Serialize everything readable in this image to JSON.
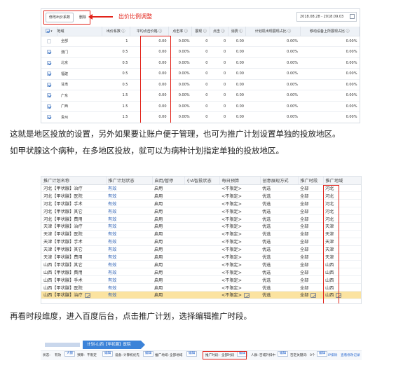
{
  "shot1": {
    "adjust_button": "修改出价系数",
    "delete_button": "删除",
    "annotation": "出价比例调整",
    "date_range": "2018.08.28 - 2018.09.03",
    "headers": [
      "地域",
      "出价系数 ⓘ",
      "平均点击价格 ⓘ",
      "点击率 ⓘ",
      "展现 ⓘ",
      "点击 ⓘ",
      "消费 ⓘ",
      "计划机出现展现占比 ⓘ",
      "移动设备上所展现占比 ⓘ"
    ],
    "rows": [
      {
        "checked": false,
        "region": "全部",
        "ratio": "1",
        "avg": "0.00",
        "ctr": "0.00%",
        "imp": "0",
        "clk": "0",
        "cost": "0.00",
        "share1": "0.00%",
        "share2": "0.00%"
      },
      {
        "checked": true,
        "region": "澳门",
        "ratio": "0.5",
        "avg": "0.00",
        "ctr": "0.00%",
        "imp": "0",
        "clk": "0",
        "cost": "0.00",
        "share1": "0.00%",
        "share2": "0.00%"
      },
      {
        "checked": true,
        "region": "北京",
        "ratio": "0.5",
        "avg": "0.00",
        "ctr": "0.00%",
        "imp": "0",
        "clk": "0",
        "cost": "0.00",
        "share1": "0.00%",
        "share2": "0.00%"
      },
      {
        "checked": true,
        "region": "福建",
        "ratio": "0.5",
        "avg": "0.00",
        "ctr": "0.00%",
        "imp": "0",
        "clk": "0",
        "cost": "0.00",
        "share1": "0.00%",
        "share2": "0.00%"
      },
      {
        "checked": true,
        "region": "甘肃",
        "ratio": "0.5",
        "avg": "0.00",
        "ctr": "0.00%",
        "imp": "0",
        "clk": "0",
        "cost": "0.00",
        "share1": "0.00%",
        "share2": "0.00%"
      },
      {
        "checked": true,
        "region": "广东",
        "ratio": "1.5",
        "avg": "0.00",
        "ctr": "0.00%",
        "imp": "0",
        "clk": "0",
        "cost": "0.00",
        "share1": "0.00%",
        "share2": "0.00%"
      },
      {
        "checked": true,
        "region": "广西",
        "ratio": "1.5",
        "avg": "0.00",
        "ctr": "0.00%",
        "imp": "0",
        "clk": "0",
        "cost": "0.00",
        "share1": "0.00%",
        "share2": "0.00%"
      },
      {
        "checked": true,
        "region": "贵州",
        "ratio": "1.5",
        "avg": "0.00",
        "ctr": "0.00%",
        "imp": "0",
        "clk": "0",
        "cost": "0.00",
        "share1": "0.00%",
        "share2": "0.00%"
      }
    ]
  },
  "text": {
    "p1": "这就是地区投放的设置，另外如果要让账户便于管理，也可为推广计划设置单独的投放地区。",
    "p2": "如甲状腺这个病种，在多地区投放，就可以为病种计划指定单独的投放地区。",
    "p3": "再看时段维度，进入百度后台，点击推广计划，选择编辑推广时段。"
  },
  "shot2": {
    "headers": [
      "推广计划名称",
      "推广计划状态",
      "启用/暂停",
      "小A智投状态",
      "每日预算",
      "创意展现方式",
      "推广时段",
      "推广地域"
    ],
    "rows": [
      {
        "name": "河北【甲状腺】治疗",
        "status": "有效",
        "toggle": "启用",
        "ai": "",
        "budget": "<不限定>",
        "mode": "优选",
        "time": "全部",
        "region": "河北",
        "sel": false
      },
      {
        "name": "河北【甲状腺】医院",
        "status": "有效",
        "toggle": "启用",
        "ai": "",
        "budget": "<不限定>",
        "mode": "优选",
        "time": "全部",
        "region": "河北",
        "sel": false
      },
      {
        "name": "河北【甲状腺】手术",
        "status": "有效",
        "toggle": "启用",
        "ai": "",
        "budget": "<不限定>",
        "mode": "优选",
        "time": "全部",
        "region": "河北",
        "sel": false
      },
      {
        "name": "河北【甲状腺】其它",
        "status": "有效",
        "toggle": "启用",
        "ai": "",
        "budget": "<不限定>",
        "mode": "优选",
        "time": "全部",
        "region": "河北",
        "sel": false
      },
      {
        "name": "河北【甲状腺】费用",
        "status": "有效",
        "toggle": "启用",
        "ai": "",
        "budget": "<不限定>",
        "mode": "优选",
        "time": "全部",
        "region": "河北",
        "sel": false
      },
      {
        "name": "天津【甲状腺】治疗",
        "status": "有效",
        "toggle": "启用",
        "ai": "",
        "budget": "<不限定>",
        "mode": "优选",
        "time": "全部",
        "region": "天津",
        "sel": false
      },
      {
        "name": "天津【甲状腺】医院",
        "status": "有效",
        "toggle": "启用",
        "ai": "",
        "budget": "<不限定>",
        "mode": "优选",
        "time": "全部",
        "region": "天津",
        "sel": false
      },
      {
        "name": "天津【甲状腺】手术",
        "status": "有效",
        "toggle": "启用",
        "ai": "",
        "budget": "<不限定>",
        "mode": "优选",
        "time": "全部",
        "region": "天津",
        "sel": false
      },
      {
        "name": "天津【甲状腺】其它",
        "status": "有效",
        "toggle": "启用",
        "ai": "",
        "budget": "<不限定>",
        "mode": "优选",
        "time": "全部",
        "region": "天津",
        "sel": false
      },
      {
        "name": "天津【甲状腺】费用",
        "status": "有效",
        "toggle": "启用",
        "ai": "",
        "budget": "<不限定>",
        "mode": "优选",
        "time": "全部",
        "region": "天津",
        "sel": false
      },
      {
        "name": "山西【甲状腺】其它",
        "status": "有效",
        "toggle": "启用",
        "ai": "",
        "budget": "<不限定>",
        "mode": "优选",
        "time": "全部",
        "region": "山西",
        "sel": false
      },
      {
        "name": "山西【甲状腺】费用",
        "status": "有效",
        "toggle": "启用",
        "ai": "",
        "budget": "<不限定>",
        "mode": "优选",
        "time": "全部",
        "region": "山西",
        "sel": false
      },
      {
        "name": "山西【甲状腺】手术",
        "status": "有效",
        "toggle": "启用",
        "ai": "",
        "budget": "<不限定>",
        "mode": "优选",
        "time": "全部",
        "region": "山西",
        "sel": false
      },
      {
        "name": "山西【甲状腺】医院",
        "status": "有效",
        "toggle": "启用",
        "ai": "",
        "budget": "<不限定>",
        "mode": "优选",
        "time": "全部",
        "region": "山西",
        "sel": false
      },
      {
        "name": "山西【甲状腺】治疗",
        "status": "有效",
        "toggle": "启用",
        "ai": "",
        "budget": "<不限定>",
        "mode": "优选",
        "time": "全部",
        "region": "山西",
        "sel": true
      }
    ]
  },
  "shot3": {
    "crumb_tag": "计划-山西【甲状腺】医院",
    "status_label": "状态:",
    "status_value": "有效",
    "status_link": "大额",
    "budget_label": "预算:",
    "budget_value": "不限定",
    "budget_edit": "编辑",
    "device_label": "设备:",
    "device_value": "计算机优先",
    "device_edit": "编辑",
    "region_label": "推广地域:",
    "region_value": "全部地域",
    "region_edit": "编辑",
    "time_label": "推广时段:",
    "time_value": "全部时段",
    "time_edit": "编辑",
    "crowd_label": "人群:",
    "crowd_value": "否城外排中",
    "crowd_edit": "编辑",
    "ip_label": "否定关键词:",
    "ip_value": "0个",
    "ip_edit": "编辑",
    "ip_link": "IP排除",
    "log_link": "查看修改记录"
  }
}
